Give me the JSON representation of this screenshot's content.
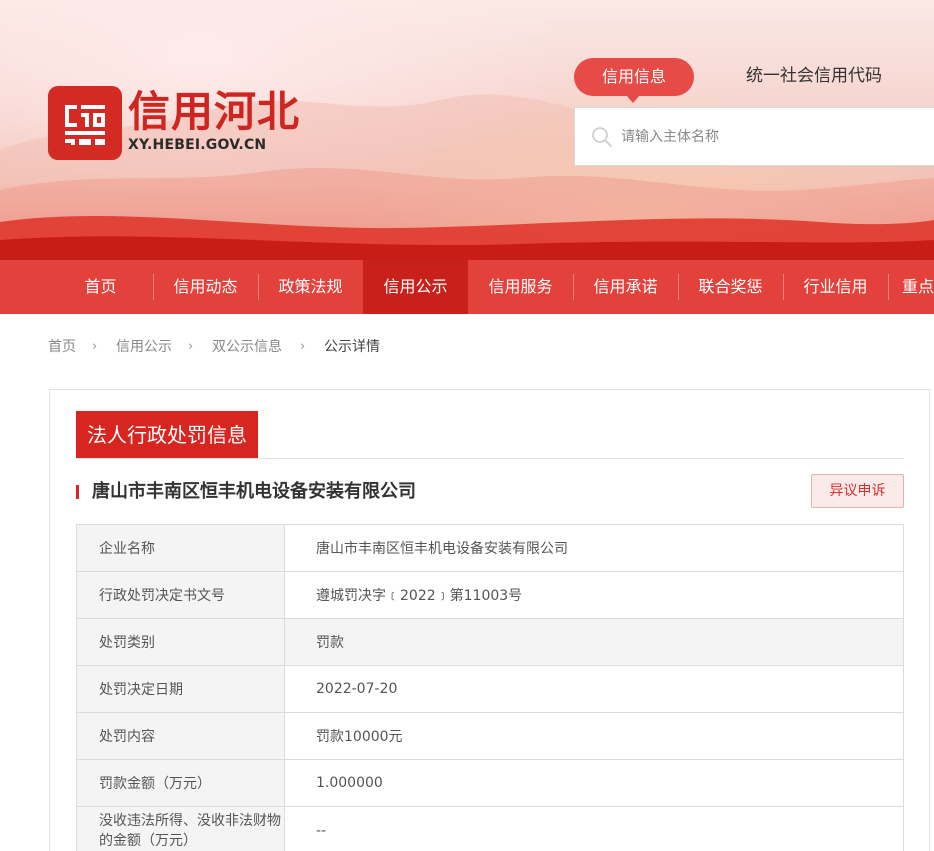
{
  "header": {
    "logo_title": "信用河北",
    "logo_url": "XY.HEBEI.GOV.CN",
    "search_tabs": [
      "信用信息",
      "统一社会信用代码"
    ],
    "search_placeholder": "请输入主体名称"
  },
  "nav": {
    "items": [
      "首页",
      "信用动态",
      "政策法规",
      "信用公示",
      "信用服务",
      "信用承诺",
      "联合奖惩",
      "行业信用",
      "重点"
    ],
    "active": "信用公示"
  },
  "breadcrumb": [
    "首页",
    "信用公示",
    "双公示信息",
    "公示详情"
  ],
  "section": {
    "title": "法人行政处罚信息",
    "company": "唐山市丰南区恒丰机电设备安装有限公司",
    "objection_button": "异议申诉"
  },
  "table": {
    "rows": [
      {
        "label": "企业名称",
        "value": "唐山市丰南区恒丰机电设备安装有限公司"
      },
      {
        "label": "行政处罚决定书文号",
        "value": "遵城罚决字﹝2022﹞第11003号"
      },
      {
        "label": "处罚类别",
        "value": "罚款"
      },
      {
        "label": "处罚决定日期",
        "value": "2022-07-20"
      },
      {
        "label": "处罚内容",
        "value": "罚款10000元"
      },
      {
        "label": "罚款金额（万元）",
        "value": "1.000000"
      },
      {
        "label": "没收违法所得、没收非法财物的金额（万元）",
        "value": "--"
      }
    ]
  },
  "colors": {
    "brand_red": "#d9251f",
    "nav_bg": "#e2413c",
    "nav_active": "#c8201b"
  }
}
